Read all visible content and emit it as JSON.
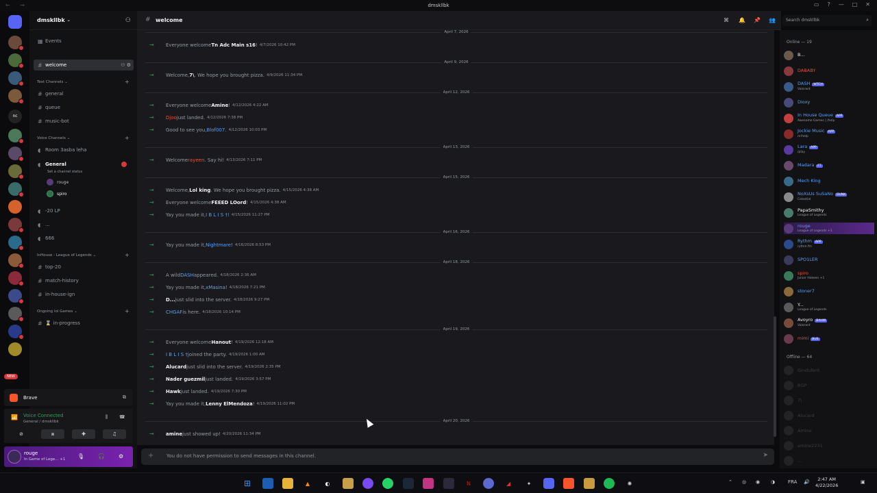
{
  "window": {
    "title": "dmskllbk"
  },
  "server": {
    "name": "dmskllbk",
    "events_label": "Events"
  },
  "channels": {
    "current": "welcome",
    "text_category": "Text Channels",
    "text": [
      "general",
      "queue",
      "music-bot"
    ],
    "voice_category": "Voice Channels",
    "voice_room": "Room 3asba leha",
    "general_voice": "General",
    "general_status": "Set a channel status",
    "voice_users": [
      "rouge",
      "spiro"
    ],
    "extra": [
      "-20 LP",
      "...",
      "666"
    ],
    "inhouse_category": "InHouse - League of Legends",
    "inhouse": [
      "top-20",
      "match-history",
      "in-house-ign"
    ],
    "ongoing_category": "Ongoing lol Games",
    "ongoing": [
      "in-progress"
    ]
  },
  "brave": {
    "label": "Brave"
  },
  "voice": {
    "status": "Voice Connected",
    "location": "General / dmskllbk"
  },
  "user": {
    "name": "rouge",
    "status": "In Game of Lege... +1"
  },
  "header": {
    "channel": "welcome",
    "search_placeholder": "Search dmskllbk"
  },
  "chat": {
    "top_divider": "April 7, 2026",
    "blocks": [
      {
        "date": "April 9, 2026",
        "msgs": [
          {
            "pre": "Everyone welcome ",
            "who": "Tn Adc Main s16",
            "post": "!",
            "ts": "4/7/2026 10:42 PM"
          }
        ]
      },
      {
        "date": "April 12, 2026",
        "msgs": [
          {
            "pre": "Welcome, ",
            "who": "7\\",
            "post": ". We hope you brought pizza.",
            "ts": "4/9/2026 11:34 PM"
          }
        ]
      },
      {
        "date": "April 13, 2026",
        "msgs": [
          {
            "pre": "Everyone welcome ",
            "who": "Amine",
            "post": "!",
            "ts": "4/12/2026 4:22 AM"
          },
          {
            "pre": "",
            "who": "Djoo",
            "post": " just landed.",
            "ts": "4/12/2026 7:38 PM",
            "color": "#e0533f"
          },
          {
            "pre": "Good to see you, ",
            "who": "Blof007",
            "post": ".",
            "ts": "4/12/2026 10:03 PM",
            "color": "#5aa0f2"
          }
        ]
      },
      {
        "date": "April 15, 2026",
        "msgs": [
          {
            "pre": "Welcome ",
            "who": "rayeen",
            "post": ". Say hi!",
            "ts": "4/13/2026 7:11 PM",
            "color": "#e0533f"
          }
        ]
      },
      {
        "date": "April 16, 2026",
        "msgs": [
          {
            "pre": "Welcome, ",
            "who": "Lol king",
            "post": ". We hope you brought pizza.",
            "ts": "4/15/2026 4:38 AM"
          },
          {
            "pre": "Everyone welcome ",
            "who": "FEEED LOord",
            "post": "!",
            "ts": "4/15/2026 4:38 AM"
          },
          {
            "pre": "Yay you made it, ",
            "who": "I B L I S †",
            "post": "!",
            "ts": "4/15/2026 11:27 PM",
            "color": "#5aa0f2"
          }
        ]
      },
      {
        "date": "April 18, 2026",
        "msgs": [
          {
            "pre": "Yay you made it, ",
            "who": "Nightmare",
            "post": "!",
            "ts": "4/16/2026 8:53 PM",
            "color": "#5aa0f2"
          }
        ]
      },
      {
        "date": "April 19, 2026",
        "msgs": [
          {
            "pre": "A wild ",
            "who": "DASH",
            "post": " appeared.",
            "ts": "4/18/2026 2:36 AM",
            "color": "#5aa0f2"
          },
          {
            "pre": "Yay you made it, ",
            "who": "xMasina",
            "post": "!",
            "ts": "4/18/2026 7:21 PM",
            "color": "#5aa0f2"
          },
          {
            "pre": "",
            "who": "D...",
            "post": " just slid into the server.",
            "ts": "4/18/2026 9:27 PM"
          },
          {
            "pre": "",
            "who": "CHGAF",
            "post": " is here.",
            "ts": "4/18/2026 10:14 PM",
            "color": "#5aa0f2"
          }
        ]
      },
      {
        "date": "April 20, 2026",
        "msgs": [
          {
            "pre": "Everyone welcome ",
            "who": "Hanout",
            "post": "!",
            "ts": "4/19/2026 12:18 AM"
          },
          {
            "pre": "",
            "who": "I B L I S †",
            "post": " joined the party.",
            "ts": "4/19/2026 1:00 AM",
            "color": "#5aa0f2"
          },
          {
            "pre": "",
            "who": "Alucard",
            "post": " just slid into the server.",
            "ts": "4/19/2026 2:35 PM"
          },
          {
            "pre": "",
            "who": "Nader guezmil",
            "post": " just landed.",
            "ts": "4/19/2026 3:57 PM"
          },
          {
            "pre": "",
            "who": "Hawk",
            "post": " just landed.",
            "ts": "4/19/2026 7:30 PM"
          },
          {
            "pre": "Yay you made it, ",
            "who": "Lenny ElMendoza",
            "post": "!",
            "ts": "4/19/2026 11:02 PM"
          }
        ]
      },
      {
        "date": "",
        "msgs": [
          {
            "pre": "",
            "who": "amine",
            "post": " just showed up!",
            "ts": "4/20/2026 11:34 PM"
          }
        ]
      }
    ]
  },
  "composer": {
    "placeholder": "You do not have permission to send messages in this channel."
  },
  "members": {
    "online_label": "Online — 19",
    "online": [
      {
        "name": "B...",
        "color": "#f2f3f5"
      },
      {
        "name": "DABABY",
        "color": "#e0533f"
      },
      {
        "name": "DASH",
        "sub": "Valorant",
        "color": "#5aa0f2",
        "tag": "WTCH"
      },
      {
        "name": "Dioxy",
        "color": "#5aa0f2"
      },
      {
        "name": "In House Queue",
        "sub": "Awesome Games | /help",
        "color": "#5aa0f2",
        "tag": "APP"
      },
      {
        "name": "Jockie Music",
        "sub": "m!help",
        "color": "#5aa0f2",
        "tag": "APP"
      },
      {
        "name": "Lara",
        "sub": "/play",
        "color": "#5aa0f2",
        "tag": "APP"
      },
      {
        "name": "Madara",
        "color": "#5aa0f2",
        "tag": "FT"
      },
      {
        "name": "Mech King",
        "color": "#5aa0f2"
      },
      {
        "name": "NoXsUs SuSaNo",
        "sub": "Celestial",
        "color": "#5aa0f2",
        "tag": "DUNK"
      },
      {
        "name": "PapaSmithy",
        "sub": "League of Legends",
        "color": "#f2f3f5"
      },
      {
        "name": "rouge",
        "sub": "League of Legends +1",
        "color": "#5aa0f2"
      },
      {
        "name": "Rythm",
        "sub": "rythm.fm",
        "color": "#5aa0f2",
        "tag": "APP"
      },
      {
        "name": "SPO1LER",
        "color": "#5aa0f2"
      },
      {
        "name": "spiro",
        "sub": "Junior Hokeen +1",
        "color": "#e0533f"
      },
      {
        "name": "stoner7",
        "color": "#5aa0f2"
      },
      {
        "name": "Y...",
        "sub": "League of Legends",
        "color": "#f2f3f5"
      },
      {
        "name": "Avoyro",
        "sub": "Valorant",
        "color": "#f2f3f5",
        "tag": "BAHW"
      },
      {
        "name": "mimi",
        "color": "#e0533f",
        "tag": "BUS"
      }
    ],
    "offline_label": "Offline — 64",
    "offline": [
      "Ginduferit",
      "RGP",
      "7\\",
      "Alucard",
      "Amine",
      "amine2231",
      "..."
    ]
  },
  "taskbar": {
    "lang": "FRA",
    "time": "2:47 AM",
    "date": "4/22/2026"
  }
}
